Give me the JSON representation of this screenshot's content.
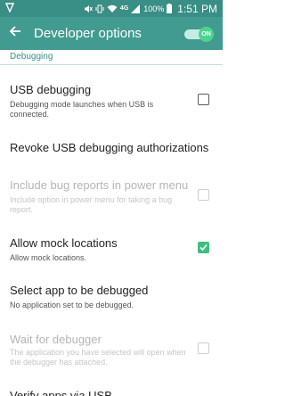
{
  "status_bar": {
    "battery": "100%",
    "time": "1:51 PM",
    "network": "4G"
  },
  "app_bar": {
    "title": "Developer options",
    "toggle_label": "ON"
  },
  "section": {
    "header": "Debugging"
  },
  "settings": [
    {
      "title": "USB debugging",
      "summary": "Debugging mode launches when USB is connected.",
      "checkbox": "unchecked",
      "enabled": true
    },
    {
      "title": "Revoke USB debugging authorizations",
      "summary": "",
      "checkbox": "none",
      "enabled": true
    },
    {
      "title": "Include bug reports in power menu",
      "summary": "Include option in power menu for taking a bug report.",
      "checkbox": "unchecked",
      "enabled": false
    },
    {
      "title": "Allow mock locations",
      "summary": "Allow mock locations.",
      "checkbox": "checked",
      "enabled": true
    },
    {
      "title": "Select app to be debugged",
      "summary": "No application set to be debugged.",
      "checkbox": "none",
      "enabled": true
    },
    {
      "title": "Wait for debugger",
      "summary": "The application you have selected will open when the debugger has attached.",
      "checkbox": "unchecked",
      "enabled": false
    },
    {
      "title": "Verify apps via USB",
      "summary": "",
      "checkbox": "none",
      "enabled": true
    }
  ],
  "colors": {
    "status_bar": "#398e85",
    "app_bar": "#429b91",
    "accent": "#3a8f87",
    "check": "#3fbf7f"
  }
}
